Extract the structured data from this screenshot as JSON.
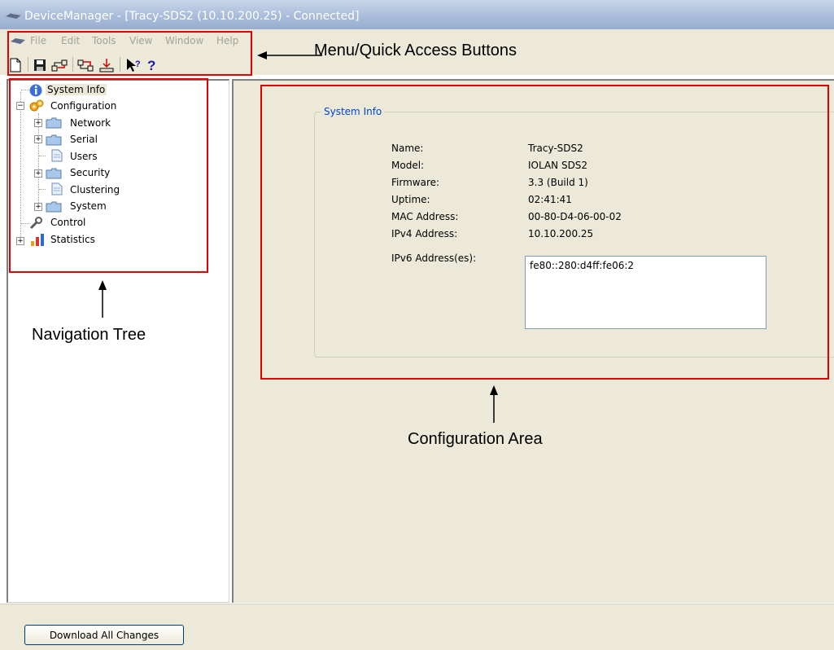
{
  "window": {
    "title": "DeviceManager - [Tracy-SDS2 (10.10.200.25) - Connected]"
  },
  "menu": [
    "File",
    "Edit",
    "Tools",
    "View",
    "Window",
    "Help"
  ],
  "toolbar": {
    "icons": [
      "new-file-icon",
      "save-icon",
      "upload-icon",
      "download-icon",
      "download-all-icon",
      "whats-this-help-icon",
      "help-icon"
    ]
  },
  "tree": {
    "system_info": "System Info",
    "configuration": "Configuration",
    "network": "Network",
    "serial": "Serial",
    "users": "Users",
    "security": "Security",
    "clustering": "Clustering",
    "system": "System",
    "control": "Control",
    "statistics": "Statistics"
  },
  "panel": {
    "legend": "System Info",
    "fields": [
      {
        "label": "Name:",
        "value": "Tracy-SDS2"
      },
      {
        "label": "Model:",
        "value": "IOLAN SDS2"
      },
      {
        "label": "Firmware:",
        "value": "3.3 (Build 1)"
      },
      {
        "label": "Uptime:",
        "value": "02:41:41"
      },
      {
        "label": "MAC Address:",
        "value": "00-80-D4-06-00-02"
      },
      {
        "label": "IPv4 Address:",
        "value": "10.10.200.25"
      },
      {
        "label": "IPv6 Address(es):",
        "value": "fe80::280:d4ff:fe06:2"
      }
    ]
  },
  "buttons": {
    "download_all": "Download All Changes"
  },
  "annotations": {
    "menu": "Menu/Quick Access Buttons",
    "navigation": "Navigation Tree",
    "configuration": "Configuration Area"
  },
  "colors": {
    "annotation_box": "#e30000",
    "legend_text": "#0046d5"
  }
}
